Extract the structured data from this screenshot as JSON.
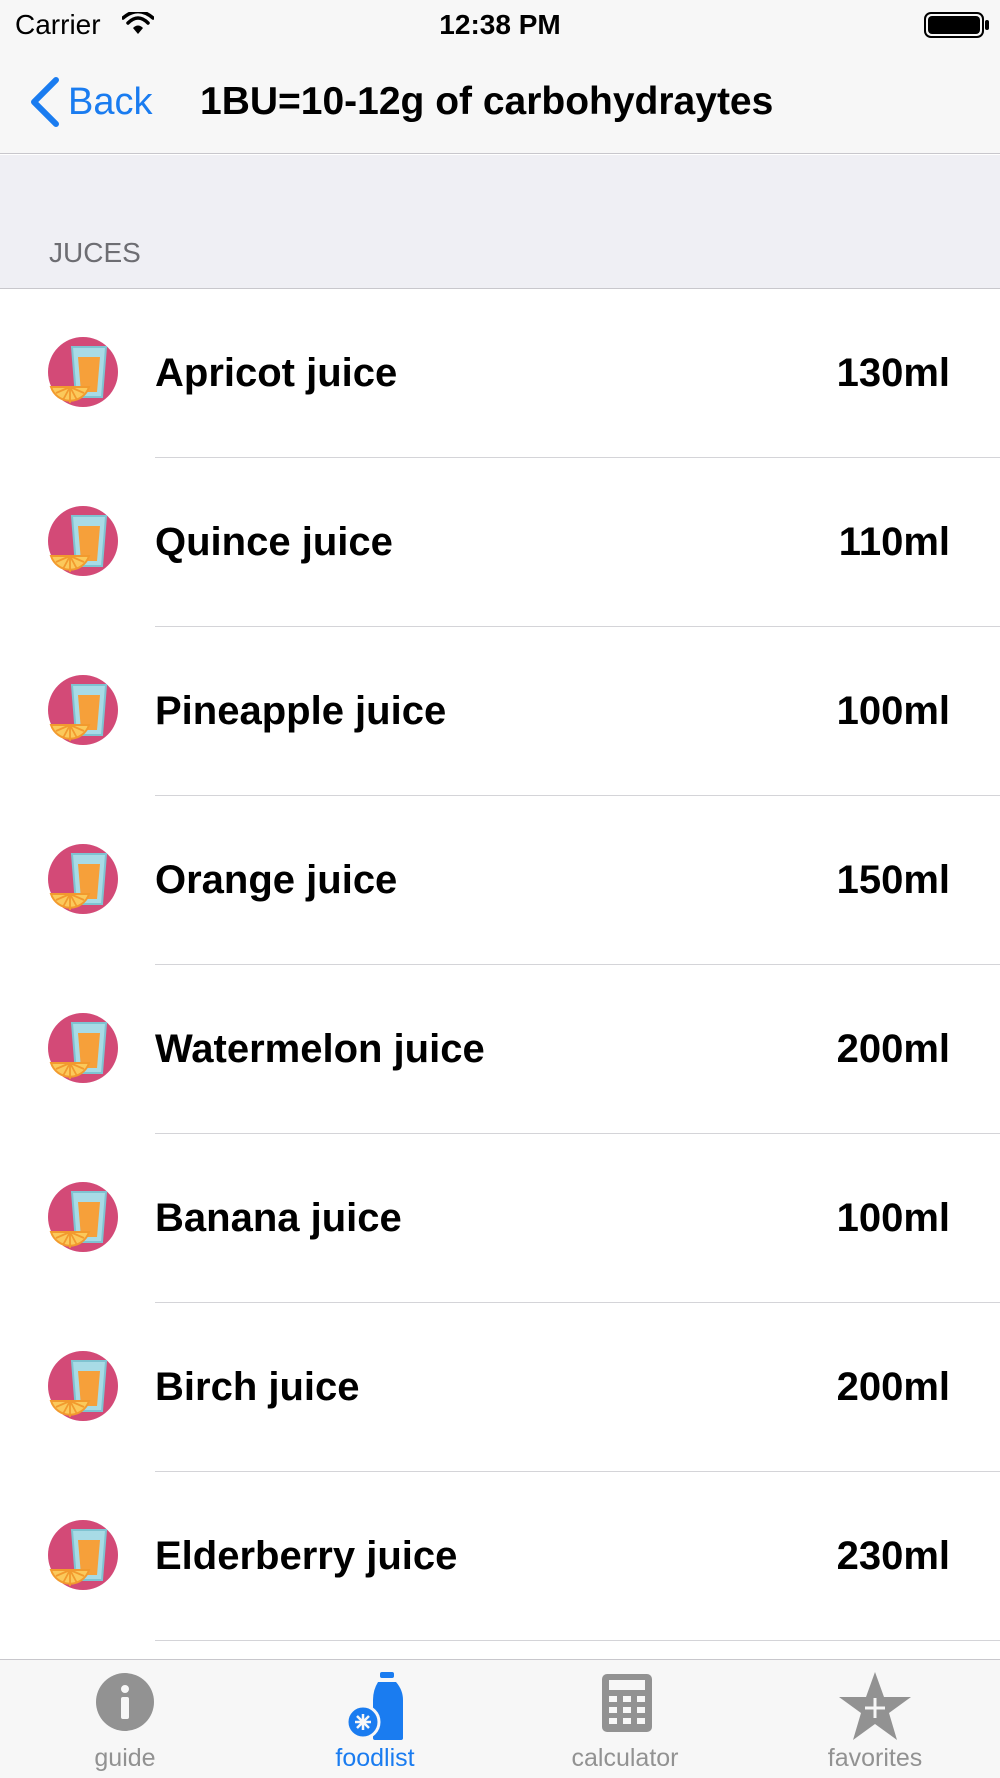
{
  "status_bar": {
    "carrier": "Carrier",
    "time": "12:38 PM"
  },
  "nav": {
    "back_label": "Back",
    "title": "1BU=10-12g of carbohydraytes"
  },
  "section": {
    "title": "JUCES"
  },
  "items": [
    {
      "name": "Apricot juice",
      "amount": "130ml",
      "icon": "juice-glass-icon"
    },
    {
      "name": "Quince juice",
      "amount": "110ml",
      "icon": "juice-glass-icon"
    },
    {
      "name": "Pineapple juice",
      "amount": "100ml",
      "icon": "juice-glass-icon"
    },
    {
      "name": "Orange juice",
      "amount": "150ml",
      "icon": "juice-glass-icon"
    },
    {
      "name": "Watermelon juice",
      "amount": "200ml",
      "icon": "juice-glass-icon"
    },
    {
      "name": "Banana juice",
      "amount": "100ml",
      "icon": "juice-glass-icon"
    },
    {
      "name": "Birch juice",
      "amount": "200ml",
      "icon": "juice-glass-icon"
    },
    {
      "name": "Elderberry juice",
      "amount": "230ml",
      "icon": "juice-glass-icon"
    }
  ],
  "tabs": [
    {
      "label": "guide",
      "icon": "info-icon",
      "active": false
    },
    {
      "label": "foodlist",
      "icon": "bottle-icon",
      "active": true
    },
    {
      "label": "calculator",
      "icon": "calculator-icon",
      "active": false
    },
    {
      "label": "favorites",
      "icon": "star-plus-icon",
      "active": false
    }
  ],
  "colors": {
    "accent": "#1a7cf0",
    "inactive": "#929292",
    "icon_circle": "#d34a77"
  }
}
